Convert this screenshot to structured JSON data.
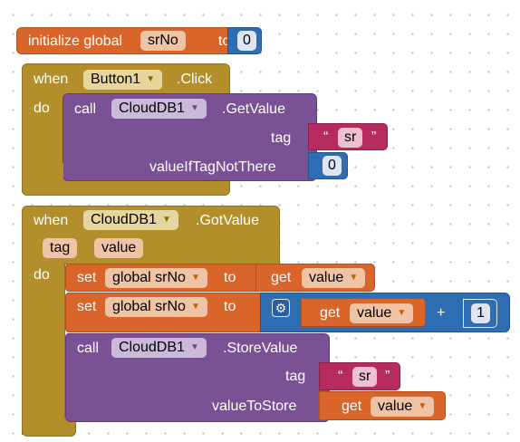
{
  "init": {
    "label": "initialize global",
    "var_name": "srNo",
    "to_label": "to",
    "value": "0"
  },
  "click_event": {
    "when_label": "when",
    "component": "Button1",
    "event": ".Click",
    "do_label": "do",
    "call_label": "call",
    "db_component": "CloudDB1",
    "method": ".GetValue",
    "tag_label": "tag",
    "tag_text": "sr",
    "quote_open": "“",
    "quote_close": "”",
    "default_label": "valueIfTagNotThere",
    "default_value": "0"
  },
  "got_event": {
    "when_label": "when",
    "component": "CloudDB1",
    "event": ".GotValue",
    "param_tag": "tag",
    "param_value": "value",
    "do_label": "do",
    "set1": {
      "set_label": "set",
      "var_name": "global srNo",
      "to_label": "to",
      "get_label": "get",
      "get_var": "value"
    },
    "set2": {
      "set_label": "set",
      "var_name": "global srNo",
      "to_label": "to",
      "get_label": "get",
      "get_var": "value",
      "op": "+",
      "operand": "1"
    },
    "call": {
      "call_label": "call",
      "db_component": "CloudDB1",
      "method": ".StoreValue",
      "tag_label": "tag",
      "tag_text": "sr",
      "quote_open": "“",
      "quote_close": "”",
      "store_label": "valueToStore",
      "get_label": "get",
      "get_var": "value"
    }
  },
  "dropdown_arrow": "▼",
  "gear_icon": "gear-icon"
}
